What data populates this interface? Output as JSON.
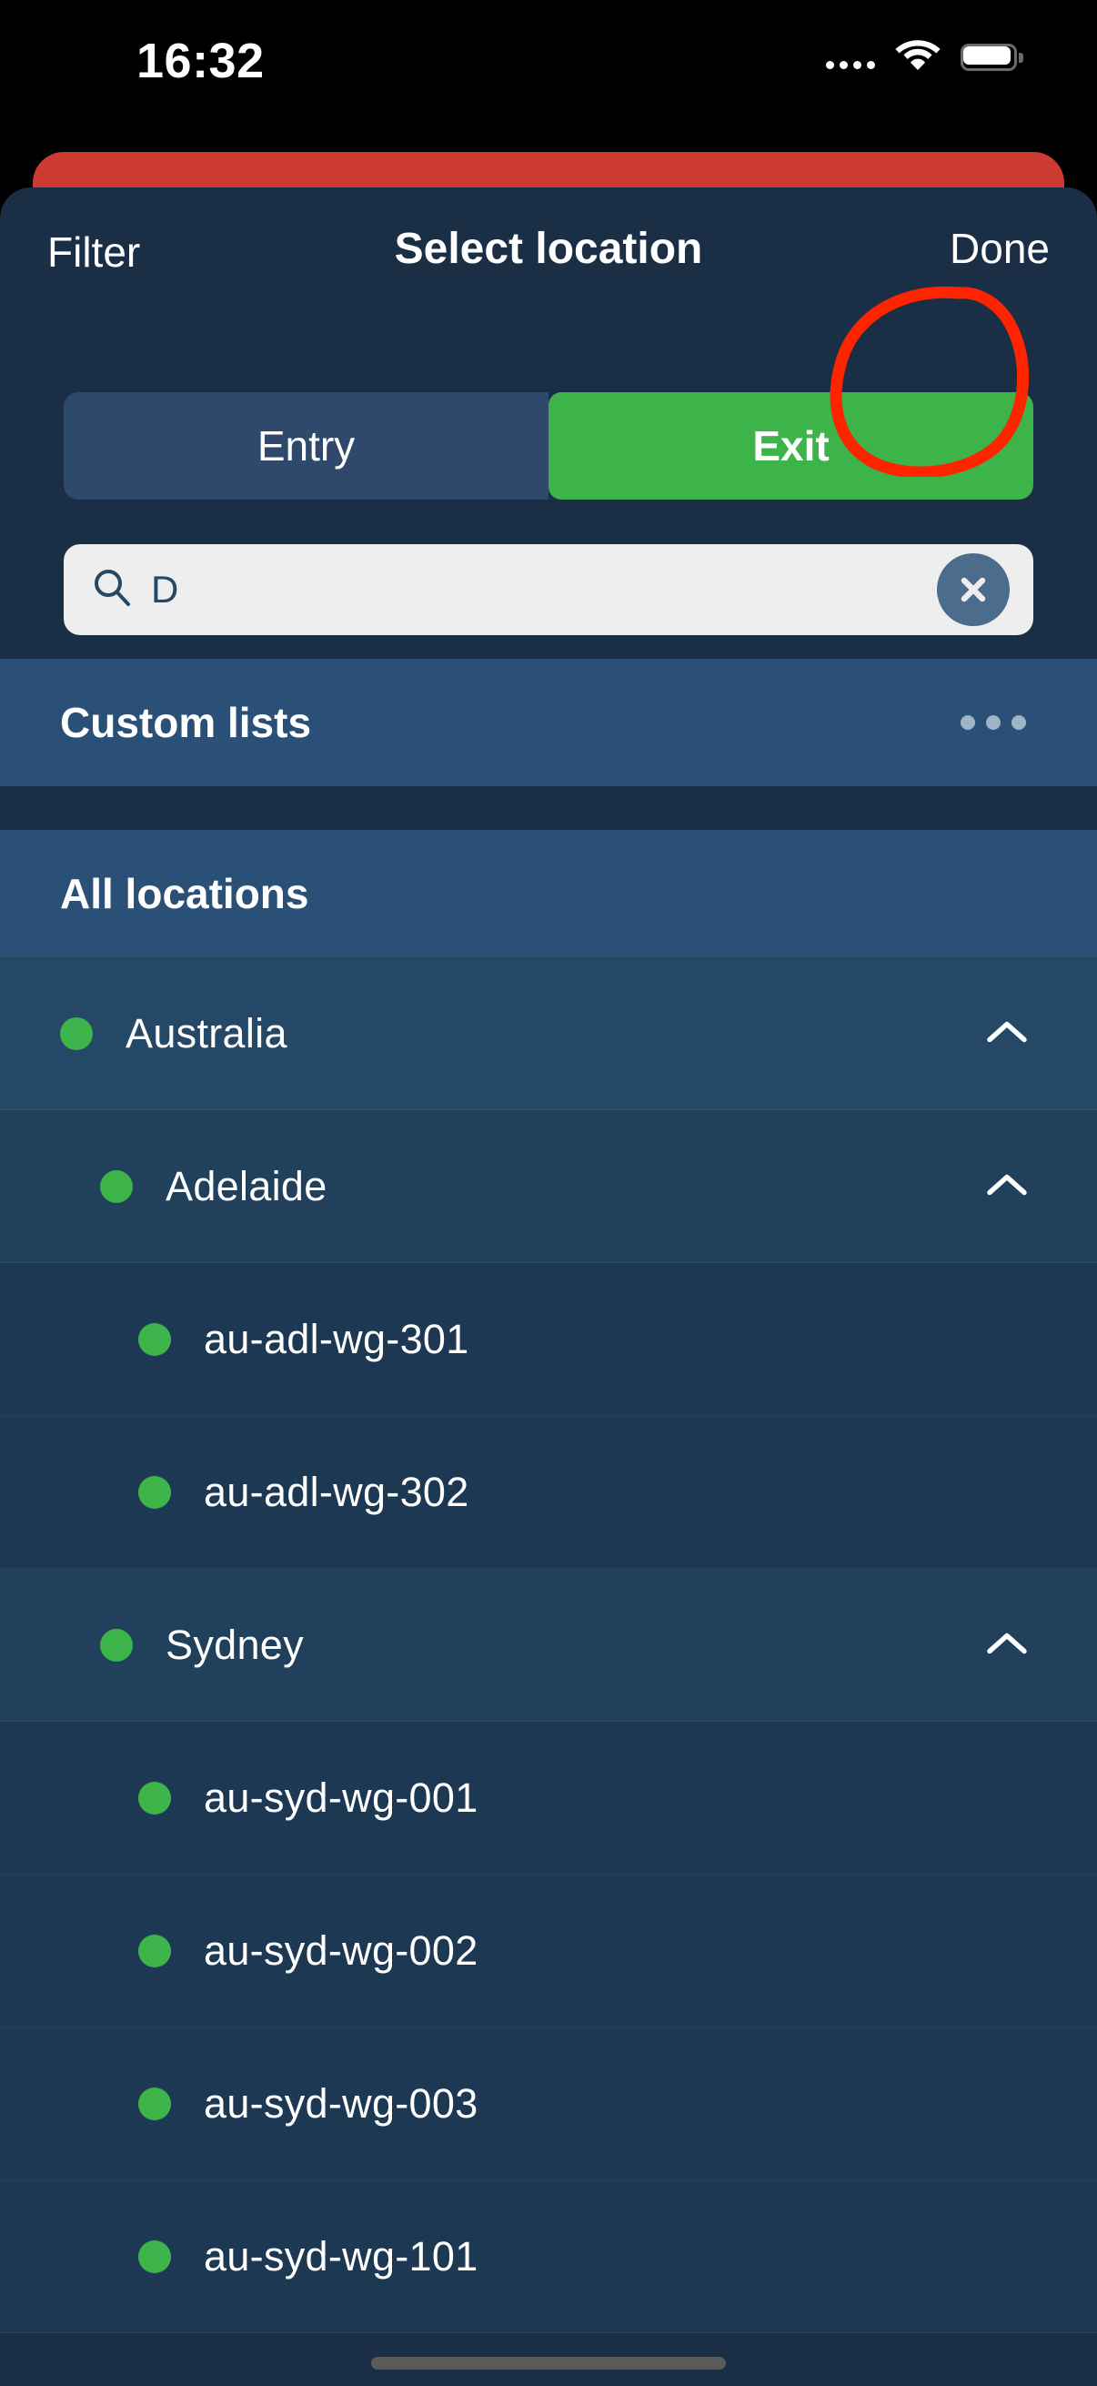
{
  "status_bar": {
    "time": "16:32",
    "cellular_icon": "cellular-dots-icon",
    "wifi_icon": "wifi-icon",
    "battery_icon": "battery-icon"
  },
  "header": {
    "left_action": "Filter",
    "title": "Select location",
    "right_action": "Done"
  },
  "segmented_control": {
    "options": [
      {
        "label": "Entry",
        "active": false
      },
      {
        "label": "Exit",
        "active": true
      }
    ],
    "active_color": "#3cb44a",
    "inactive_color": "#2e496b"
  },
  "search": {
    "value": "D",
    "placeholder": "Search",
    "search_icon": "magnifier-icon",
    "clear_icon": "close-x-icon",
    "annotation": "red-circle-highlight"
  },
  "sections": {
    "custom_lists": {
      "title": "Custom lists",
      "menu_icon": "ellipsis-icon"
    },
    "all_locations": {
      "title": "All locations"
    }
  },
  "locations": [
    {
      "name": "Australia",
      "level": 0,
      "expanded": true,
      "status_color": "#3cb44a",
      "chevron": "chevron-up-icon"
    },
    {
      "name": "Adelaide",
      "level": 1,
      "expanded": true,
      "status_color": "#3cb44a",
      "chevron": "chevron-up-icon"
    },
    {
      "name": "au-adl-wg-301",
      "level": 2,
      "expanded": null,
      "status_color": "#3cb44a",
      "chevron": null
    },
    {
      "name": "au-adl-wg-302",
      "level": 2,
      "expanded": null,
      "status_color": "#3cb44a",
      "chevron": null
    },
    {
      "name": "Sydney",
      "level": 1,
      "expanded": true,
      "status_color": "#3cb44a",
      "chevron": "chevron-up-icon"
    },
    {
      "name": "au-syd-wg-001",
      "level": 2,
      "expanded": null,
      "status_color": "#3cb44a",
      "chevron": null
    },
    {
      "name": "au-syd-wg-002",
      "level": 2,
      "expanded": null,
      "status_color": "#3cb44a",
      "chevron": null
    },
    {
      "name": "au-syd-wg-003",
      "level": 2,
      "expanded": null,
      "status_color": "#3cb44a",
      "chevron": null
    },
    {
      "name": "au-syd-wg-101",
      "level": 2,
      "expanded": null,
      "status_color": "#3cb44a",
      "chevron": null
    }
  ],
  "colors": {
    "sheet_background": "#1a2e45",
    "section_background": "#2a5078",
    "card_behind": "#cd3a32",
    "accent_green": "#3cb44a",
    "annotation_red": "#ff2400",
    "search_field": "#eeeeee"
  }
}
